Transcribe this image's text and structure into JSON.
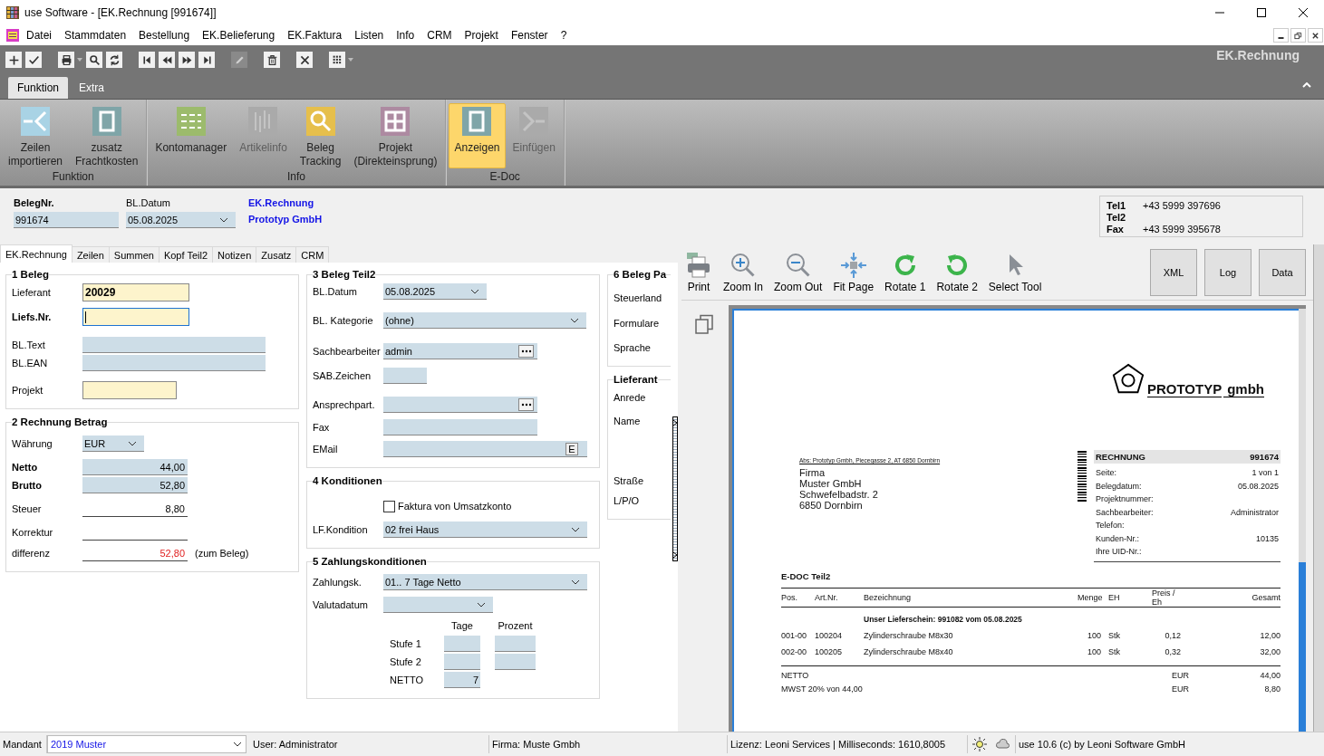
{
  "window": {
    "title": "use Software - [EK.Rechnung [991674]]"
  },
  "menu": [
    "Datei",
    "Stammdaten",
    "Bestellung",
    "EK.Belieferung",
    "EK.Faktura",
    "Listen",
    "Info",
    "CRM",
    "Projekt",
    "Fenster",
    "?"
  ],
  "toolbar": [
    {
      "kind": "add",
      "disabled": false
    },
    {
      "kind": "save",
      "disabled": false
    },
    {
      "kind": "print",
      "disabled": false
    },
    {
      "kind": "find",
      "disabled": false
    },
    {
      "kind": "refresh",
      "disabled": false
    },
    {
      "kind": "first",
      "disabled": false
    },
    {
      "kind": "previous",
      "disabled": false
    },
    {
      "kind": "next",
      "disabled": false
    },
    {
      "kind": "last",
      "disabled": false
    },
    {
      "kind": "edit",
      "disabled": true
    },
    {
      "kind": "delete",
      "disabled": false
    },
    {
      "kind": "cancel",
      "disabled": false
    },
    {
      "kind": "grid",
      "disabled": false
    }
  ],
  "module_title": "EK.Rechnung",
  "ribbon": {
    "tabs": [
      {
        "label": "Funktion",
        "selected": true
      },
      {
        "label": "Extra",
        "selected": false
      }
    ],
    "groups": [
      {
        "label": "Funktion",
        "buttons": [
          {
            "lines": [
              "Zeilen",
              "importieren"
            ],
            "kind": "import",
            "disabled": false,
            "selected": false
          },
          {
            "lines": [
              "zusatz",
              "Frachtkosten"
            ],
            "kind": "frame",
            "disabled": false,
            "selected": false
          }
        ]
      },
      {
        "label": "Info",
        "buttons": [
          {
            "lines": [
              "Kontomanager"
            ],
            "kind": "list",
            "disabled": false,
            "selected": false
          },
          {
            "lines": [
              "Artikelinfo"
            ],
            "kind": "bars",
            "disabled": true,
            "selected": false
          },
          {
            "lines": [
              "Beleg",
              "Tracking"
            ],
            "kind": "search",
            "disabled": false,
            "selected": false
          },
          {
            "lines": [
              "Projekt",
              "(Direkteinsprung)"
            ],
            "kind": "grid",
            "disabled": false,
            "selected": false
          }
        ]
      },
      {
        "label": "E-Doc",
        "buttons": [
          {
            "lines": [
              "Anzeigen"
            ],
            "kind": "frame",
            "disabled": false,
            "selected": true
          },
          {
            "lines": [
              "Einfügen"
            ],
            "kind": "insert",
            "disabled": true,
            "selected": false
          }
        ]
      }
    ]
  },
  "header": {
    "beleg_nr": {
      "label": "BelegNr.",
      "value": "991674"
    },
    "bl_datum": {
      "label": "BL.Datum",
      "value": "05.08.2025"
    },
    "module_link": "EK.Rechnung",
    "company": "Prototyp GmbH",
    "contact": [
      {
        "label": "Tel1",
        "value": "+43 5999 397696"
      },
      {
        "label": "Tel2"
      },
      {
        "label": "Fax",
        "value": "+43 5999 395678"
      }
    ]
  },
  "form_tabs": [
    {
      "label": "EK.Rechnung",
      "selected": true
    },
    {
      "label": "Zeilen",
      "selected": false
    },
    {
      "label": "Summen",
      "selected": false
    },
    {
      "label": "Kopf Teil2",
      "selected": false
    },
    {
      "label": "Notizen",
      "selected": false
    },
    {
      "label": "Zusatz",
      "selected": false
    },
    {
      "label": "CRM",
      "selected": false
    }
  ],
  "form": {
    "columns": [
      [
        {
          "title": "1 Beleg",
          "rows": [
            {
              "kind": "highlight",
              "label": "Lieferant",
              "value": "20029",
              "emphasis": false,
              "focused": false
            },
            {
              "kind": "highlight",
              "label": "Liefs.Nr.",
              "emphasis": true,
              "focused": true
            },
            {
              "kind": "text",
              "label": "BL.Text",
              "emphasis": false
            },
            {
              "kind": "text",
              "label": "BL.EAN",
              "emphasis": false
            },
            {
              "kind": "highlight",
              "label": "Projekt",
              "emphasis": false,
              "focused": false
            }
          ]
        },
        {
          "title": "2 Rechnung Betrag",
          "rows": [
            {
              "kind": "combo",
              "label": "Währung",
              "value": "EUR",
              "emphasis": false
            },
            {
              "kind": "amount",
              "label": "Netto",
              "value": "44,00",
              "emphasis": true,
              "alert": false
            },
            {
              "kind": "amount",
              "label": "Brutto",
              "value": "52,80",
              "emphasis": true,
              "alert": false
            },
            {
              "kind": "line",
              "label": "Steuer",
              "value": "8,80",
              "emphasis": false,
              "alert": false
            },
            {
              "kind": "line",
              "label": "Korrektur",
              "emphasis": false
            },
            {
              "kind": "line",
              "label": "differenz",
              "value": "52,80",
              "emphasis": false,
              "alert": true,
              "note": "(zum Beleg)"
            }
          ]
        }
      ],
      [
        {
          "title": "3 Beleg Teil2",
          "rows": [
            {
              "kind": "combo",
              "label": "BL.Datum",
              "value": "05.08.2025",
              "emphasis": false
            },
            {
              "kind": "combo",
              "label": "BL. Kategorie",
              "value": "(ohne)",
              "emphasis": false
            },
            {
              "kind": "lookup",
              "label": "Sachbearbeiter",
              "value": "admin",
              "emphasis": false
            },
            {
              "kind": "text",
              "label": "SAB.Zeichen",
              "emphasis": false
            },
            {
              "kind": "lookup",
              "label": "Ansprechpart.",
              "emphasis": false
            },
            {
              "kind": "text",
              "label": "Fax",
              "emphasis": false
            },
            {
              "kind": "email",
              "label": "EMail",
              "button": "E",
              "emphasis": false
            }
          ]
        },
        {
          "title": "4 Konditionen",
          "rows": [
            {
              "kind": "checkbox",
              "text": "Faktura von Umsatzkonto",
              "checked": false
            },
            {
              "kind": "combo",
              "label": "LF.Kondition",
              "value": "02 frei Haus",
              "emphasis": false
            }
          ]
        },
        {
          "title": "5 Zahlungskonditionen",
          "rows": [
            {
              "kind": "combo",
              "label": "Zahlungsk.",
              "value": "01.. 7 Tage Netto",
              "emphasis": false
            },
            {
              "kind": "combo",
              "label": "Valutadatum",
              "emphasis": false
            },
            {
              "kind": "stufen",
              "columns": [
                "Tage",
                "Prozent"
              ],
              "levels": [
                {
                  "label": "Stufe 1",
                  "fields": [
                    {
                      "kind": "tage"
                    },
                    {
                      "kind": "prozent"
                    }
                  ]
                },
                {
                  "label": "Stufe 2",
                  "fields": [
                    {
                      "kind": "tage"
                    },
                    {
                      "kind": "prozent"
                    }
                  ]
                },
                {
                  "label": "NETTO",
                  "fields": [
                    {
                      "kind": "tage",
                      "value": "7"
                    }
                  ]
                }
              ]
            }
          ]
        }
      ],
      [
        {
          "title": "6 Beleg Pa",
          "rows": [
            {
              "kind": "label",
              "label": "Steuerland"
            },
            {
              "kind": "label",
              "label": "Formulare"
            },
            {
              "kind": "label",
              "label": "Sprache"
            }
          ]
        },
        {
          "title": "Lieferant",
          "rows": [
            {
              "kind": "label",
              "label": "Anrede"
            },
            {
              "kind": "label",
              "label": "Name"
            },
            {
              "kind": "label",
              "label": "Straße"
            },
            {
              "kind": "label",
              "label": "L/P/O"
            }
          ]
        }
      ]
    ]
  },
  "viewer": {
    "tools": [
      {
        "label": "Print",
        "kind": "print"
      },
      {
        "label": "Zoom In",
        "kind": "zoom-in"
      },
      {
        "label": "Zoom Out",
        "kind": "zoom-out"
      },
      {
        "label": "Fit Page",
        "kind": "fit"
      },
      {
        "label": "Rotate 1",
        "kind": "rotate-cw"
      },
      {
        "label": "Rotate 2",
        "kind": "rotate-ccw"
      },
      {
        "label": "Select Tool",
        "kind": "pointer"
      }
    ],
    "side_buttons": [
      "XML",
      "Log",
      "Data"
    ],
    "document": {
      "logo": {
        "name": "PROTOTYP",
        "suffix": "gmbh"
      },
      "sender": "Abs: Prototyp Gmbh, Piecegasse 2, AT 6850 Dornbirn",
      "address": [
        "Firma",
        "Muster GmbH",
        "Schwefelbadstr. 2",
        "6850 Dornbirn"
      ],
      "info": {
        "title": "RECHNUNG",
        "number": "991674",
        "rows": [
          {
            "label": "Seite:",
            "value": "1 von 1"
          },
          {
            "label": "Belegdatum:",
            "value": "05.08.2025"
          },
          {
            "label": "Projektnummer:"
          },
          {
            "label": "Sachbearbeiter:",
            "value": "Administrator"
          },
          {
            "label": "Telefon:"
          },
          {
            "label": "Kunden-Nr.:",
            "value": "10135"
          },
          {
            "label": "Ihre UID-Nr.:"
          }
        ]
      },
      "section": "E-DOC Teil2",
      "columns": [
        "Pos.",
        "Art.Nr.",
        "Bezeichnung",
        "Menge",
        "EH",
        "Preis / Eh",
        "Gesamt"
      ],
      "group": "Unser Lieferschein: 991082 vom 05.08.2025",
      "rows": [
        [
          "001-00",
          "100204",
          "Zylinderschraube M8x30",
          "100",
          "Stk",
          "0,12",
          "12,00"
        ],
        [
          "002-00",
          "100205",
          "Zylinderschraube M8x40",
          "100",
          "Stk",
          "0,32",
          "32,00"
        ]
      ],
      "totals": [
        {
          "label": "NETTO",
          "currency": "EUR",
          "value": "44,00"
        },
        {
          "label": "MWST 20% von 44,00",
          "currency": "EUR",
          "value": "8,80"
        }
      ]
    }
  },
  "status_bar": {
    "mandant_label": "Mandant",
    "mandant": "2019 Muster",
    "user": "User: Administrator",
    "firma": "Firma: Muste Gmbh",
    "lizenz": "Lizenz: Leoni Services | Milliseconds: 1610,8005",
    "version": "use 10.6 (c) by Leoni Software GmbH"
  }
}
